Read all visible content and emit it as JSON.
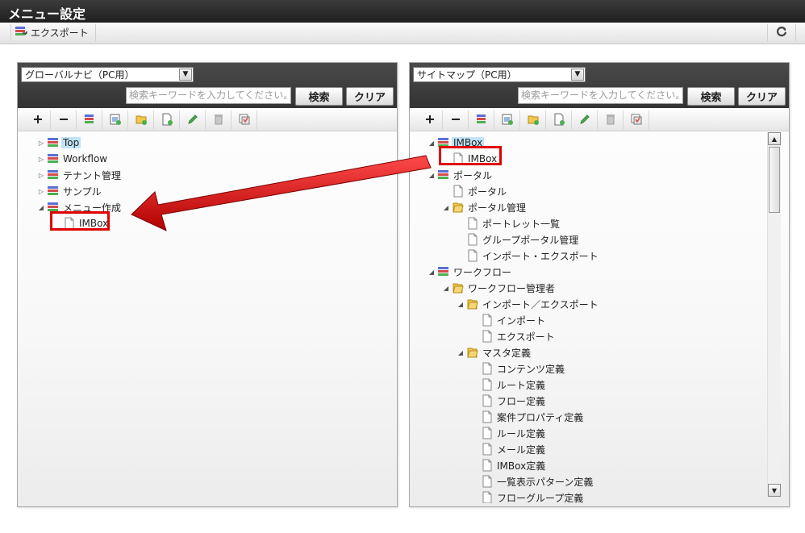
{
  "window": {
    "title": "メニュー設定"
  },
  "toolbar": {
    "export_label": "エクスポート",
    "refresh_icon": "refresh-icon"
  },
  "left_panel": {
    "menu_select": "グローバルナビ（PC用）",
    "search_placeholder": "検索キーワードを入力してください。",
    "search_button": "検索",
    "clear_button": "クリア",
    "tree": [
      {
        "label": "Top",
        "toggle": "collapsed",
        "icon": "menu-icon",
        "selected": true
      },
      {
        "label": "Workflow",
        "toggle": "collapsed",
        "icon": "menu-icon"
      },
      {
        "label": "テナント管理",
        "toggle": "collapsed",
        "icon": "menu-icon"
      },
      {
        "label": "サンプル",
        "toggle": "collapsed",
        "icon": "menu-icon"
      },
      {
        "label": "メニュー作成",
        "toggle": "expanded",
        "icon": "menu-icon"
      },
      {
        "label": "IMBox",
        "toggle": "none",
        "icon": "page-icon",
        "highlighted": true
      }
    ]
  },
  "right_panel": {
    "menu_select": "サイトマップ（PC用）",
    "search_placeholder": "検索キーワードを入力してください。",
    "search_button": "検索",
    "clear_button": "クリア",
    "tree": [
      {
        "label": "IMBox",
        "toggle": "expanded",
        "icon": "menu-icon",
        "selected": true
      },
      {
        "label": "IMBox",
        "toggle": "none",
        "icon": "page-icon",
        "highlighted": true
      },
      {
        "label": "ポータル",
        "toggle": "expanded",
        "icon": "menu-icon"
      },
      {
        "label": "ポータル",
        "toggle": "none",
        "icon": "page-icon"
      },
      {
        "label": "ポータル管理",
        "toggle": "expanded",
        "icon": "folder-icon"
      },
      {
        "label": "ポートレット一覧",
        "toggle": "none",
        "icon": "page-icon"
      },
      {
        "label": "グループポータル管理",
        "toggle": "none",
        "icon": "page-icon"
      },
      {
        "label": "インポート・エクスポート",
        "toggle": "none",
        "icon": "page-icon"
      },
      {
        "label": "ワークフロー",
        "toggle": "expanded",
        "icon": "menu-icon"
      },
      {
        "label": "ワークフロー管理者",
        "toggle": "expanded",
        "icon": "folder-icon"
      },
      {
        "label": "インポート／エクスポート",
        "toggle": "expanded",
        "icon": "folder-icon"
      },
      {
        "label": "インポート",
        "toggle": "none",
        "icon": "page-icon"
      },
      {
        "label": "エクスポート",
        "toggle": "none",
        "icon": "page-icon"
      },
      {
        "label": "マスタ定義",
        "toggle": "expanded",
        "icon": "folder-icon"
      },
      {
        "label": "コンテンツ定義",
        "toggle": "none",
        "icon": "page-icon"
      },
      {
        "label": "ルート定義",
        "toggle": "none",
        "icon": "page-icon"
      },
      {
        "label": "フロー定義",
        "toggle": "none",
        "icon": "page-icon"
      },
      {
        "label": "案件プロパティ定義",
        "toggle": "none",
        "icon": "page-icon"
      },
      {
        "label": "ルール定義",
        "toggle": "none",
        "icon": "page-icon"
      },
      {
        "label": "メール定義",
        "toggle": "none",
        "icon": "page-icon"
      },
      {
        "label": "IMBox定義",
        "toggle": "none",
        "icon": "page-icon"
      },
      {
        "label": "一覧表示パターン定義",
        "toggle": "none",
        "icon": "page-icon"
      },
      {
        "label": "フローグループ定義",
        "toggle": "none",
        "icon": "page-icon"
      }
    ]
  },
  "tree_tools": [
    "add-icon",
    "remove-icon",
    "add-menu-icon",
    "add-group-icon",
    "add-folder-icon",
    "add-page-icon",
    "edit-icon",
    "delete-icon",
    "copy-icon"
  ],
  "colors": {
    "highlight": "#e10000",
    "selected_bg": "#bfe3f7",
    "arrow": "#d40000"
  }
}
